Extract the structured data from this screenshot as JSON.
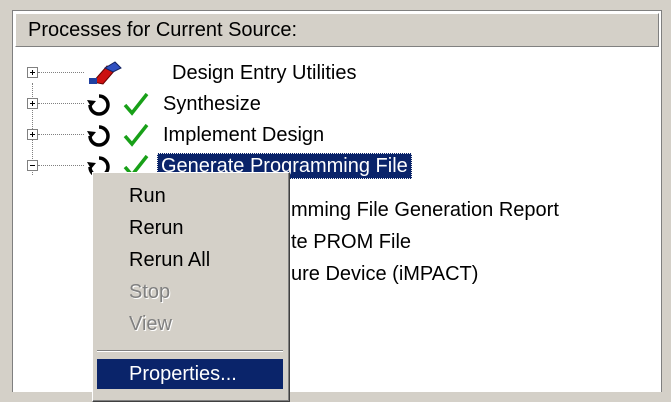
{
  "panel": {
    "title": "Processes for Current Source:"
  },
  "tree": {
    "items": [
      {
        "label": "Design Entry Utilities",
        "icon": "design-entry-icon"
      },
      {
        "label": "Synthesize",
        "icon": "rerun-checkmark-icon"
      },
      {
        "label": "Implement Design",
        "icon": "rerun-checkmark-icon"
      },
      {
        "label": "Generate Programming File",
        "icon": "rerun-checkmark-icon",
        "selected": true
      }
    ],
    "children": [
      {
        "visible_text": "mming File Generation Report"
      },
      {
        "visible_text": "te PROM File"
      },
      {
        "visible_text": "ure Device (iMPACT)"
      }
    ]
  },
  "context_menu": {
    "items": [
      {
        "label": "Run",
        "enabled": true
      },
      {
        "label": "Rerun",
        "enabled": true
      },
      {
        "label": "Rerun All",
        "enabled": true
      },
      {
        "label": "Stop",
        "enabled": false
      },
      {
        "label": "View",
        "enabled": false
      },
      {
        "label": "Properties...",
        "enabled": true,
        "highlighted": true
      }
    ]
  },
  "colors": {
    "selection": "#0a246a",
    "check": "#20a020",
    "window_bg": "#d4d0c8"
  }
}
